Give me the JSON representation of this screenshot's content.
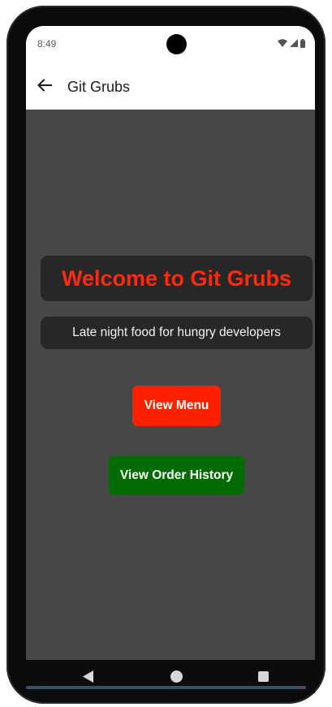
{
  "status_bar": {
    "time": "8:49",
    "icons": [
      "wifi-icon",
      "cellular-signal-icon",
      "battery-icon"
    ]
  },
  "app_bar": {
    "back_icon": "arrow-left-icon",
    "title": "Git Grubs"
  },
  "main": {
    "welcome_title": "Welcome to Git Grubs",
    "tagline": "Late night food for hungry developers",
    "view_menu_label": "View Menu",
    "view_order_history_label": "View Order History"
  },
  "nav_bar": {
    "icons": [
      "nav-back-icon",
      "nav-home-icon",
      "nav-recents-icon"
    ]
  },
  "colors": {
    "accent_red": "#ff2000",
    "title_red": "#ff2a0e",
    "accent_green": "#056b05",
    "background": "#474747",
    "card": "#272727"
  }
}
